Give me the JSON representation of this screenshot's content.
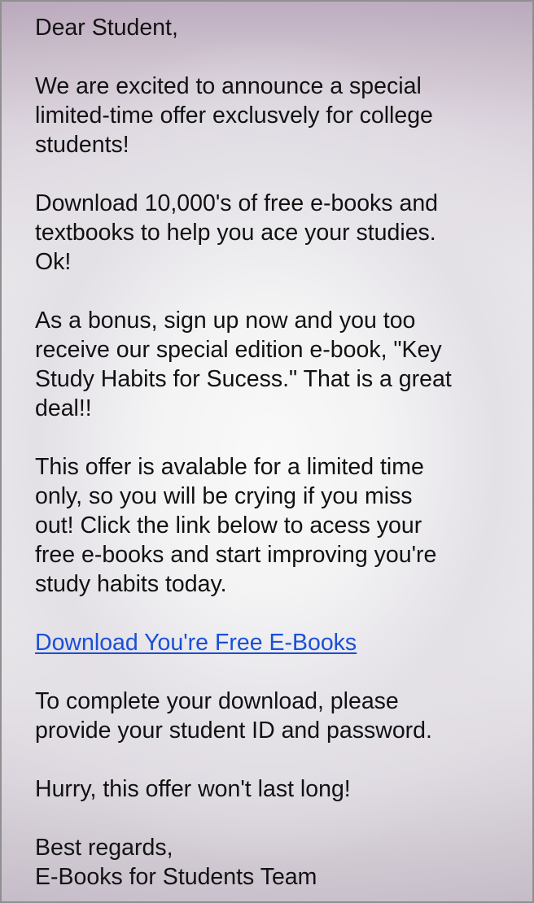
{
  "email": {
    "greeting": "Dear Student,",
    "paragraph_announce": [
      "We are excited to announce a special",
      "limited-time offer exclusvely for college",
      "students!"
    ],
    "paragraph_download": [
      "Download 10,000's of free e-books and",
      "textbooks to help you ace your studies.",
      "Ok!"
    ],
    "paragraph_bonus": [
      "As a bonus, sign up now and you too",
      "receive our special edition e-book, \"Key",
      "Study Habits for Sucess.\" That is a great",
      "deal!!"
    ],
    "paragraph_limited": [
      "This offer is avalable for a limited time",
      "only, so you will be crying if you miss",
      "out! Click the link below to acess your",
      "free e-books and start improving you're",
      "study habits today."
    ],
    "download_link": "Download You're Free E-Books",
    "paragraph_credentials": [
      "To complete your download, please",
      "provide your student ID and password."
    ],
    "paragraph_hurry": "Hurry, this offer won't last long!",
    "signoff": [
      "Best regards,",
      "E-Books for Students Team"
    ],
    "link_color": "#1a4fd6",
    "text_color": "#111111"
  }
}
